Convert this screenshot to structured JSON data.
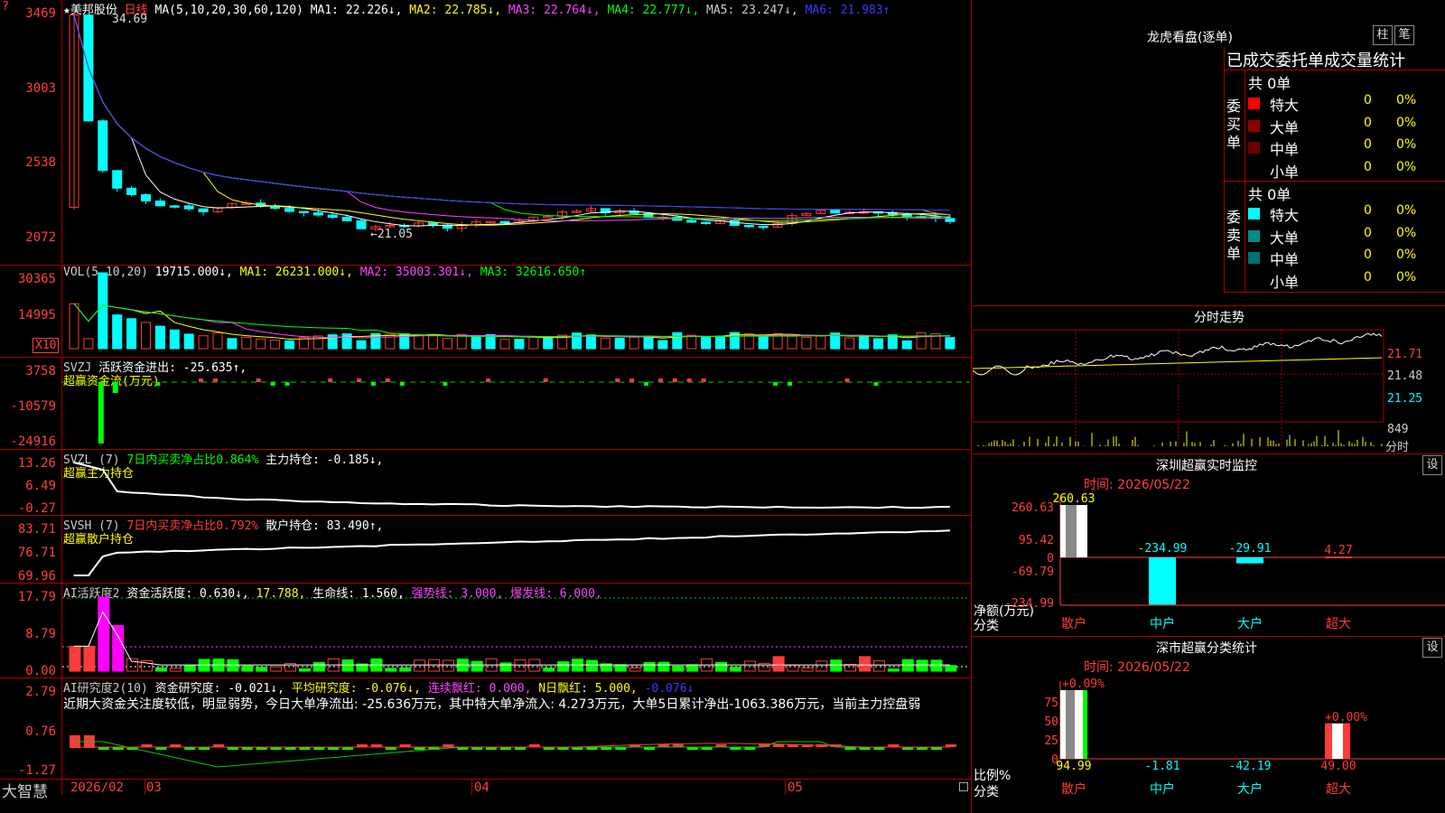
{
  "colors": {
    "up": "#ff3b3b",
    "down": "#00ffff",
    "grid": "#aa0000",
    "white": "#ffffff",
    "yellow": "#ffff00",
    "magenta": "#ff44ff",
    "green": "#00ff00"
  },
  "header": {
    "stock_name": "★美邦股份",
    "period": "日线",
    "ma_label": "MA(5,10,20,30,60,120)",
    "ma1": "MA1: 22.226↓,",
    "ma2": "MA2: 22.785↓,",
    "ma3": "MA3: 22.764↓,",
    "ma4": "MA4: 22.777↓,",
    "ma5": "MA5: 23.247↓,",
    "ma6": "MA6: 21.983↑"
  },
  "price_panel": {
    "y_labels": [
      "3469",
      "3003",
      "2538",
      "2072"
    ],
    "annotations": {
      "high": "34.69",
      "low": "←21.05"
    },
    "marker": "?"
  },
  "vol_panel": {
    "title": "VOL(5,10,20)",
    "value": "19715.000↓,",
    "ma1": "MA1: 26231.000↓,",
    "ma2": "MA2: 35003.301↓,",
    "ma3": "MA3: 32616.650↑",
    "y_labels": [
      "30365",
      "14995"
    ],
    "unit": "X10"
  },
  "svzj_panel": {
    "title": "SVZJ",
    "desc": "活跃资金进出: -25.635↑,",
    "sub": "超赢资金流(万元)",
    "y_labels": [
      "3758",
      "-10579",
      "-24916"
    ]
  },
  "svzl_panel": {
    "title": "SVZL (7)",
    "desc1": "7日内买卖净占比0.864%",
    "desc2": "主力持仓: -0.185↓,",
    "sub": "超赢主力持仓",
    "y_labels": [
      "13.26",
      "6.49",
      "-0.27"
    ]
  },
  "svsh_panel": {
    "title": "SVSH (7)",
    "desc1": "7日内买卖净占比0.792%",
    "desc2": "散户持仓: 83.490↑,",
    "sub": "超赢散户持仓",
    "y_labels": [
      "83.71",
      "76.71",
      "69.96"
    ]
  },
  "ai1_panel": {
    "title": "AI活跃度2",
    "v1": "资金活跃度: 0.630↓,",
    "v2": "17.788,",
    "v3": "生命线: 1.560,",
    "v4": "强势线: 3.000,",
    "v5": "爆发线: 6.000,",
    "y_labels": [
      "17.79",
      "8.79",
      "0.00"
    ]
  },
  "ai2_panel": {
    "title": "AI研究度2(10)",
    "v1": "资金研究度: -0.021↓,",
    "v2": "平均研究度: -0.076↓,",
    "v3": "连续飘红: 0.000,",
    "v4": "N日飘红: 5.000,",
    "v5": "-0.076↓",
    "note": "近期大资金关注度较低，明显弱势，今日大单净流出: -25.636万元，其中特大单净流入: 4.273万元，大单5日累计净出-1063.386万元，当前主力控盘弱",
    "y_labels": [
      "2.79",
      "0.76",
      "-1.27"
    ]
  },
  "xaxis": {
    "labels": [
      "2026/02",
      "03",
      "04",
      "05"
    ],
    "logo": "大智慧"
  },
  "right": {
    "title": "龙虎看盘(逐单)",
    "btn1": "柱",
    "btn2": "笔",
    "stats_title": "已成交委托单成交量统计",
    "buy_label": "委买单",
    "sell_label": "委卖单",
    "buy_total": "共 0单",
    "sell_total": "共 0单",
    "buy_rows": [
      {
        "name": "特大",
        "val": "0",
        "pct": "0%",
        "color": "#ff0000"
      },
      {
        "name": "大单",
        "val": "0",
        "pct": "0%",
        "color": "#8b0000"
      },
      {
        "name": "中单",
        "val": "0",
        "pct": "0%",
        "color": "#6a0000"
      },
      {
        "name": "小单",
        "val": "0",
        "pct": "0%",
        "color": ""
      }
    ],
    "sell_rows": [
      {
        "name": "特大",
        "val": "0",
        "pct": "0%",
        "color": "#00ffff"
      },
      {
        "name": "大单",
        "val": "0",
        "pct": "0%",
        "color": "#008b8b"
      },
      {
        "name": "中单",
        "val": "0",
        "pct": "0%",
        "color": "#007070"
      },
      {
        "name": "小单",
        "val": "0",
        "pct": "0%",
        "color": ""
      }
    ],
    "intraday_title": "分时走势",
    "intraday_y": [
      "21.71",
      "21.48",
      "21.25"
    ],
    "intraday_vol": "849",
    "intraday_unit": "分时",
    "monitor_title": "深圳超赢实时监控",
    "monitor_btn": "设",
    "monitor_time": "时间: 2026/05/22",
    "monitor_y": [
      "260.63",
      "95.42",
      "0",
      "-69.79",
      "-234.99"
    ],
    "monitor_ylabel1": "净额(万元)",
    "monitor_ylabel2": "分类",
    "monitor_cats": [
      "散户",
      "中户",
      "大户",
      "超大"
    ],
    "monitor_values": [
      "260.63",
      "-234.99",
      "-29.91",
      "4.27"
    ],
    "class_title": "深市超赢分类统计",
    "class_btn": "设",
    "class_time": "时间: 2026/05/22",
    "class_y": [
      "75",
      "50",
      "25",
      "0"
    ],
    "class_ylabel1": "比例%",
    "class_ylabel2": "分类",
    "class_cats": [
      "散户",
      "中户",
      "大户",
      "超大"
    ],
    "class_top": [
      "+0.09%",
      "",
      "",
      "+0.00%"
    ],
    "class_values": [
      "94.99",
      "-1.81",
      "-42.19",
      "49.00"
    ]
  },
  "chart_data": [
    {
      "type": "candlestick",
      "title": "美邦股份 日线",
      "ylabels": [
        "3469",
        "3003",
        "2538",
        "2072"
      ],
      "ma_values": {
        "MA1": 22.226,
        "MA2": 22.785,
        "MA3": 22.764,
        "MA4": 22.777,
        "MA5": 23.247,
        "MA6": 21.983
      }
    },
    {
      "type": "bar",
      "title": "VOL(5,10,20)",
      "latest": 19715.0
    },
    {
      "type": "bar",
      "title": "深圳超赢实时监控",
      "categories": [
        "散户",
        "中户",
        "大户",
        "超大"
      ],
      "values": [
        260.63,
        -234.99,
        -29.91,
        4.27
      ]
    },
    {
      "type": "bar",
      "title": "深市超赢分类统计",
      "categories": [
        "散户",
        "中户",
        "大户",
        "超大"
      ],
      "values": [
        94.99,
        -1.81,
        -42.19,
        49.0
      ]
    }
  ]
}
